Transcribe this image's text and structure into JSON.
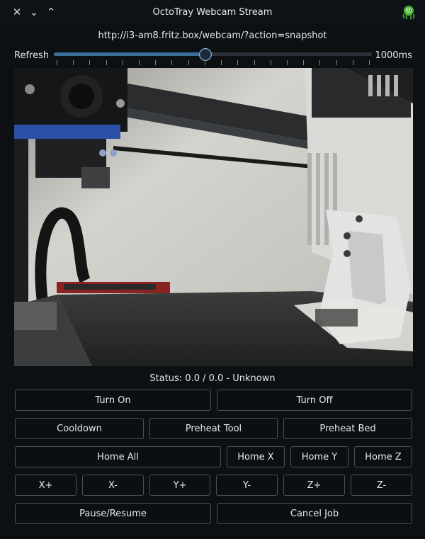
{
  "window": {
    "title": "OctoTray Webcam Stream",
    "controls": {
      "close": "✕",
      "minimize": "⌄",
      "maximize": "⌃"
    },
    "app_icon": "octoprint-icon"
  },
  "stream_url": "http://i3-am8.fritz.box/webcam/?action=snapshot",
  "refresh": {
    "label": "Refresh",
    "value_label": "1000ms",
    "level": 0.477
  },
  "webcam": {
    "image": "3d-printer-webcam-snapshot"
  },
  "status": "Status: 0.0 / 0.0 - Unknown",
  "buttons": {
    "turn_on": "Turn On",
    "turn_off": "Turn Off",
    "cooldown": "Cooldown",
    "preheat_tool": "Preheat Tool",
    "preheat_bed": "Preheat Bed",
    "home_all": "Home All",
    "home_x": "Home X",
    "home_y": "Home Y",
    "home_z": "Home Z",
    "x_plus": "X+",
    "x_minus": "X-",
    "y_plus": "Y+",
    "y_minus": "Y-",
    "z_plus": "Z+",
    "z_minus": "Z-",
    "pause_resume": "Pause/Resume",
    "cancel_job": "Cancel Job"
  },
  "colors": {
    "accent": "#3d6d99",
    "background": "#0c1013",
    "button_border": "#4a5057"
  }
}
